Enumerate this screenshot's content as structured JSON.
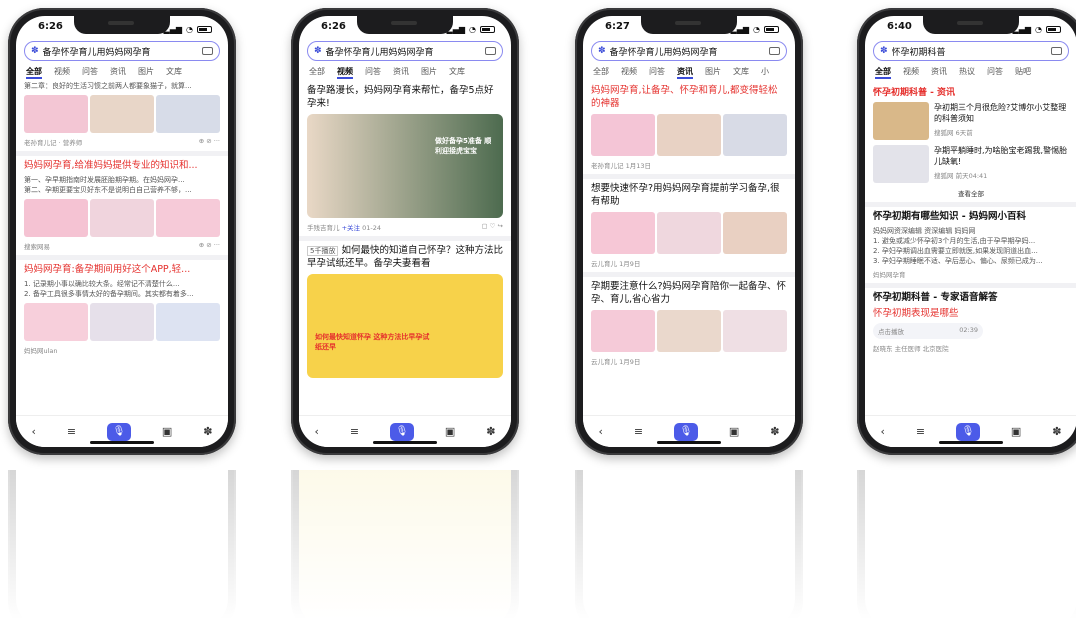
{
  "phones": [
    {
      "time": "6:26",
      "search": "备孕怀孕育儿用妈妈网孕育",
      "tabs": [
        "全部",
        "视频",
        "问答",
        "资讯",
        "图片",
        "文库"
      ],
      "items": [
        {
          "sub": "第二章：良好的生活习惯之前两人都要象猫子，就算..."
        },
        {
          "meta": "老孙育儿记 · 营养师"
        },
        {
          "title": "妈妈网孕育,给准妈妈提供专业的知识和...",
          "sub1": "第一、孕早期指南时发展胚胎期孕期。在妈妈网孕...",
          "sub2": "第二、孕期更要宝贝好东不是说明白自己营养不够，...",
          "meta": "搜索网易"
        },
        {
          "title": "妈妈网孕育:备孕期间用好这个APP,轻...",
          "sub1": "1. 记录期小事以确比较大条。经常记不清楚什么...",
          "sub2": "2. 备孕工具很多事情太好的备孕期间。其实都有着多...",
          "meta": "妈妈网ulan"
        }
      ]
    },
    {
      "time": "6:26",
      "search": "备孕怀孕育儿用妈妈网孕育",
      "tabs": [
        "全部",
        "视频",
        "问答",
        "资讯",
        "图片",
        "文库"
      ],
      "items": [
        {
          "title": "备孕路漫长，妈妈网孕育来帮忙，备孕5点好孕来!"
        },
        {
          "hero": "做好备孕5准备 顺利迎接虎宝宝",
          "author": "手残吉育儿",
          "follow": "+关注",
          "date": "01-24"
        },
        {
          "title": "如何最快的知道自己怀孕？这种方法比早孕试纸还早。备孕夫妻看看",
          "tag": "5千播放"
        },
        {
          "hero": "如何最快知道怀孕 这种方法比早孕试纸还早"
        }
      ]
    },
    {
      "time": "6:27",
      "search": "备孕怀孕育儿用妈妈网孕育",
      "tabs": [
        "全部",
        "视频",
        "问答",
        "资讯",
        "图片",
        "文库",
        "小"
      ],
      "items": [
        {
          "title": "妈妈网孕育,让备孕、怀孕和育儿,都变得轻松的神器",
          "meta": "老孙育儿记 1月13日"
        },
        {
          "title": "想要快速怀孕?用妈妈网孕育提前学习备孕,很有帮助",
          "meta": "云儿育儿 1月9日"
        },
        {
          "title": "孕期要注意什么?妈妈网孕育陪你一起备孕、怀孕、育儿,省心省力",
          "meta": "云儿育儿 1月9日"
        }
      ]
    },
    {
      "time": "6:40",
      "search": "怀孕初期科普",
      "tabs": [
        "全部",
        "视频",
        "资讯",
        "热议",
        "问答",
        "贴吧"
      ],
      "items": [
        {
          "section": "怀孕初期科普 - 资讯"
        },
        {
          "title": "孕初期三个月很危险?艾博尔小艾整理的科普须知",
          "meta": "搜狐网 6天前"
        },
        {
          "title": "孕期平躺睡时,为啥胎宝老踢我,警惕胎儿缺氧!",
          "meta": "搜狐网 前天04:41"
        },
        {
          "more": "查看全部"
        },
        {
          "section": "怀孕初期有哪些知识 - 妈妈网小百科",
          "sub1": "妈妈网资深编辑 资深编辑 妈妈网",
          "sub2": "1. 避免或减少怀孕初3个月的生活,由于孕早期孕妈...",
          "sub3": "2. 孕妇孕期调出血需要立即就医,如果发现阴道出血...",
          "sub4": "3. 孕妇孕期睡眠不适、孕后恶心、偏心、尿频已成为...",
          "meta": "妈妈网孕育"
        },
        {
          "section": "怀孕初期科普 - 专家语音解答",
          "title": "怀孕初期表现是哪些",
          "audio": "点击播放",
          "dur": "02:39",
          "expert": "赵晓东 主任医师 北京医院"
        }
      ]
    }
  ]
}
